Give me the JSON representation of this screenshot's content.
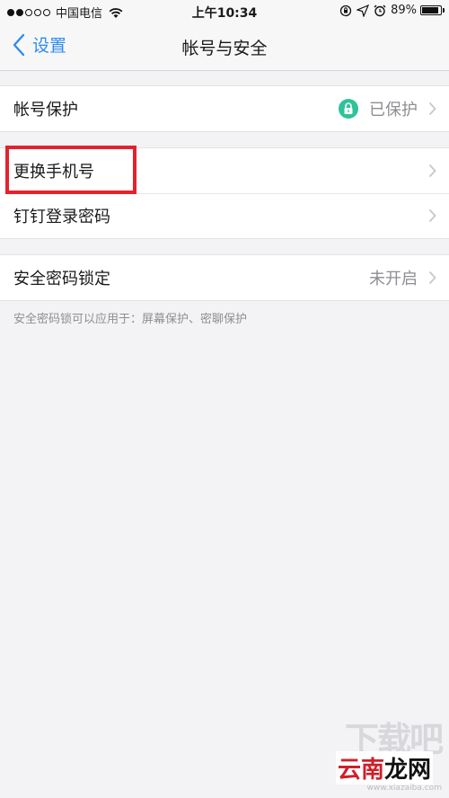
{
  "status_bar": {
    "carrier": "中国电信",
    "time": "上午10:34",
    "battery": "89%",
    "battery_level": 0.89
  },
  "nav": {
    "back_label": "设置",
    "title": "帐号与安全"
  },
  "groups": [
    {
      "rows": [
        {
          "label": "帐号保护",
          "value": "已保护",
          "icon": "lock-icon"
        }
      ]
    },
    {
      "rows": [
        {
          "label": "更换手机号",
          "value": ""
        },
        {
          "label": "钉钉登录密码",
          "value": ""
        }
      ]
    },
    {
      "rows": [
        {
          "label": "安全密码锁定",
          "value": "未开启"
        }
      ]
    }
  ],
  "footnote": "安全密码锁可以应用于：屏幕保护、密聊保护",
  "watermark": {
    "top": "下载吧",
    "main_part1": "云南",
    "main_part2": "龙网",
    "url": "www.xiazaiba.com"
  },
  "colors": {
    "accent": "#2d8cf0",
    "lock_green": "#2ec39a",
    "highlight_red": "#e3222d"
  }
}
